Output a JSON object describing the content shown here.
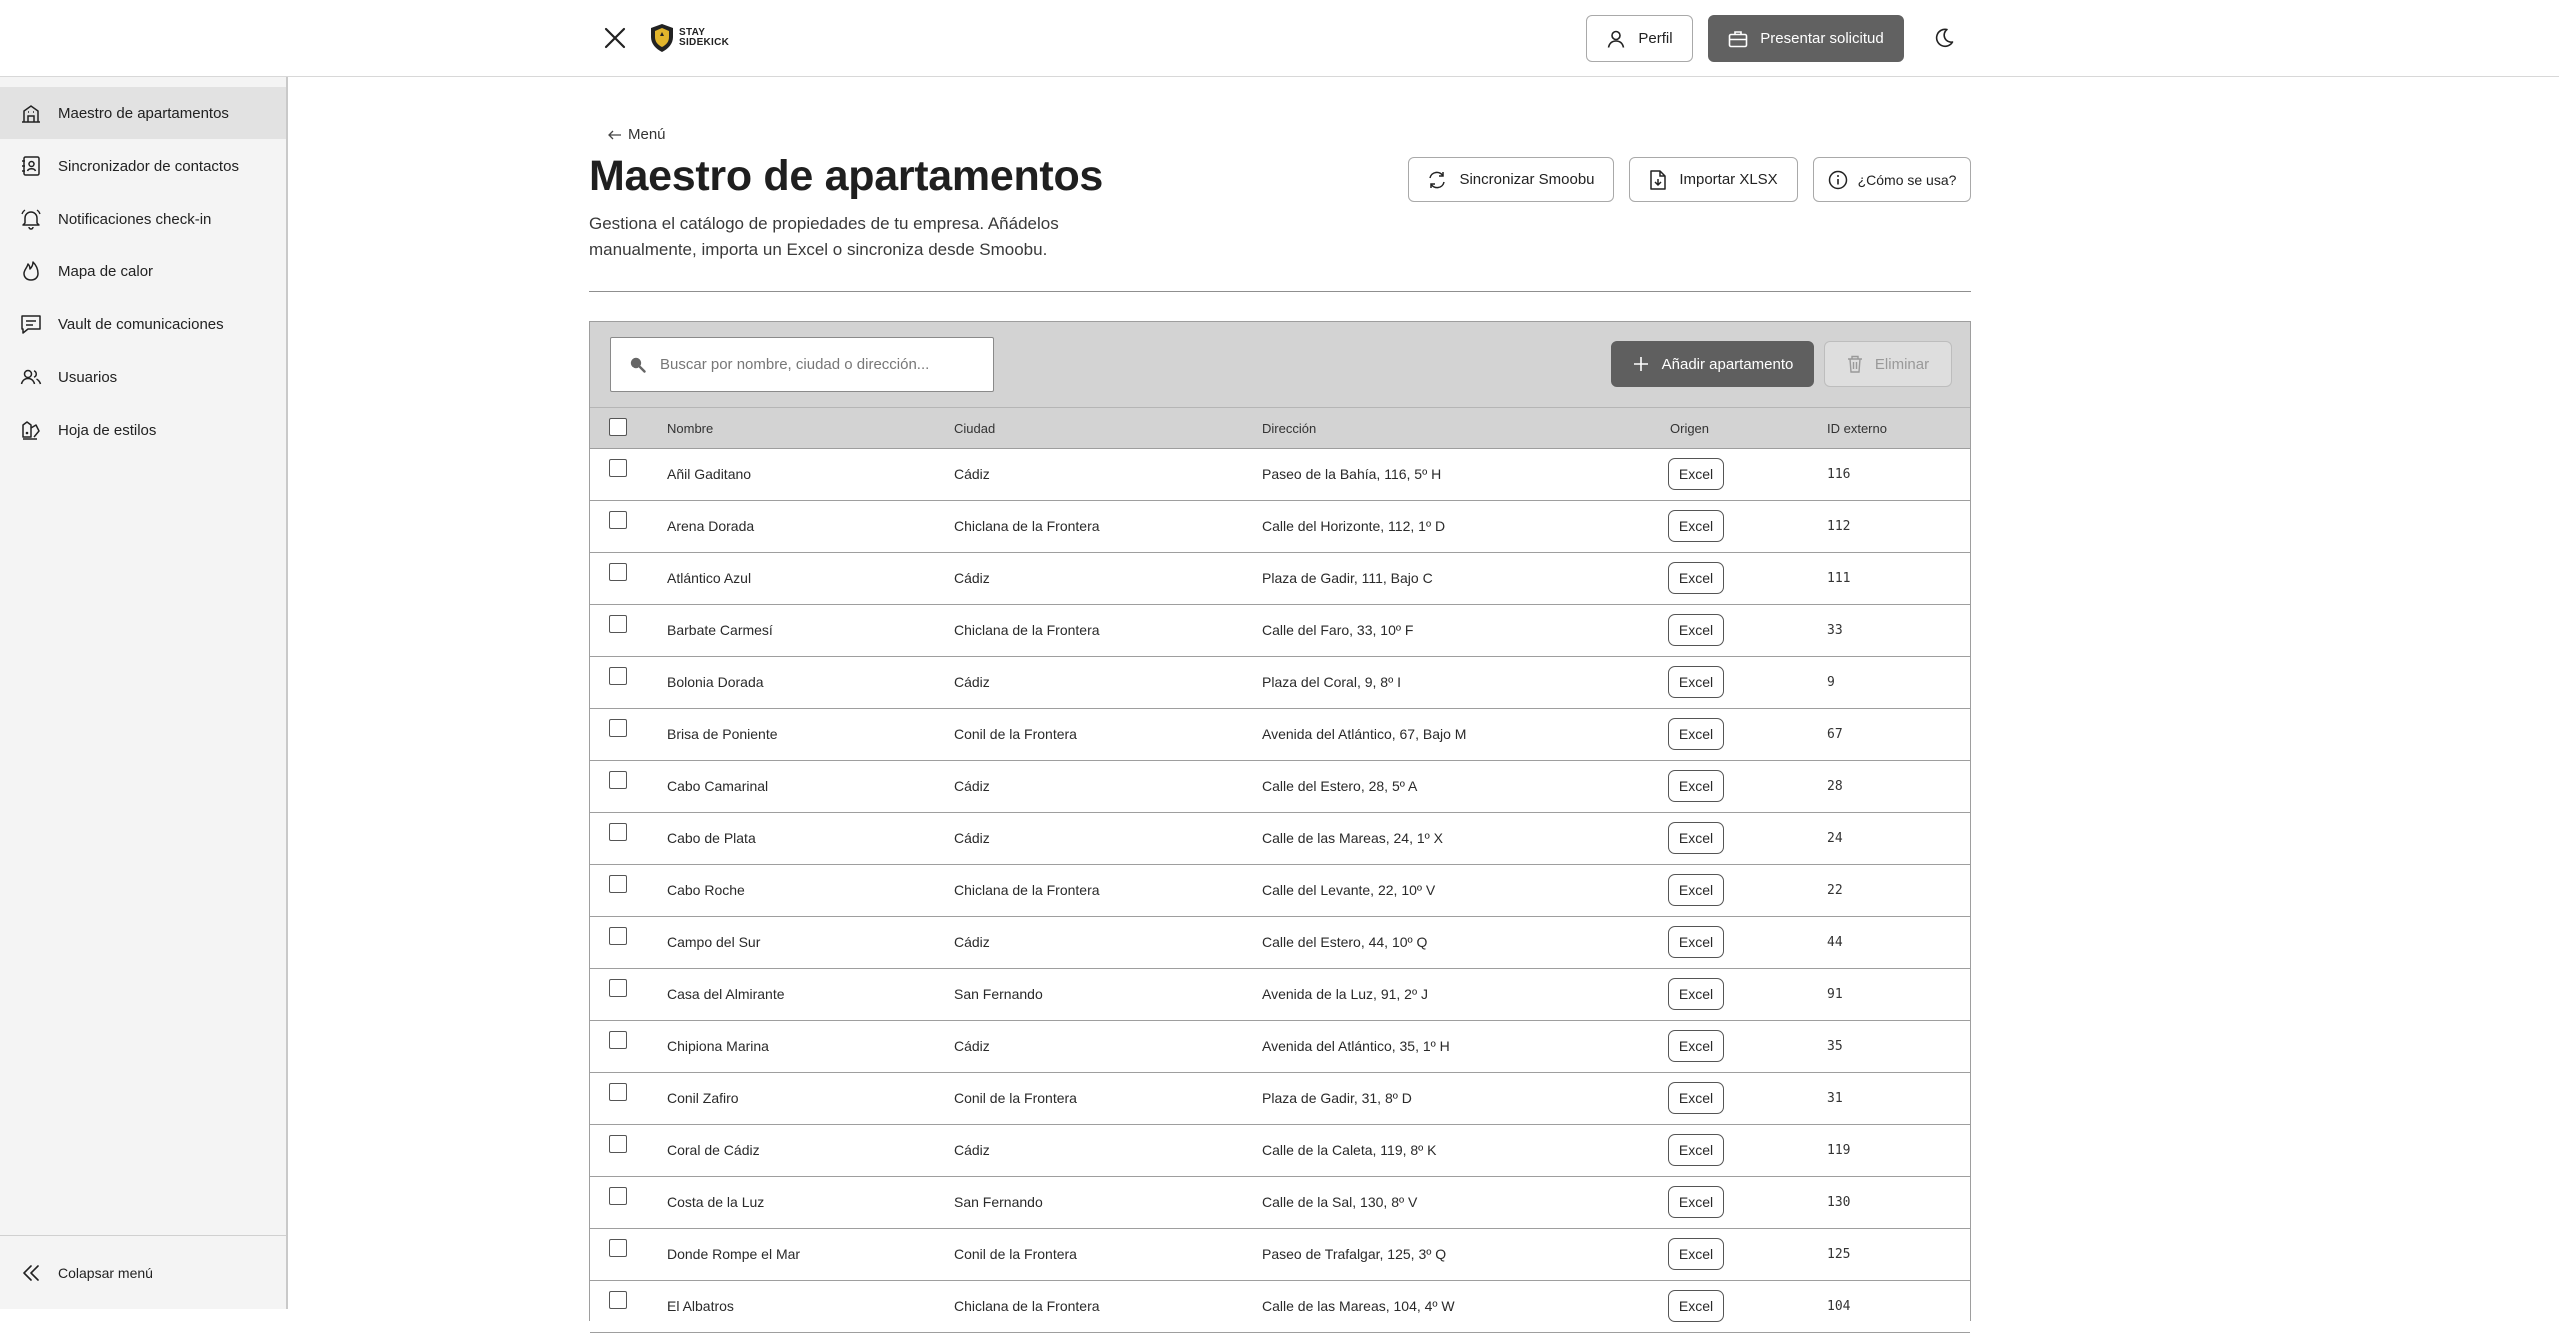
{
  "brand": {
    "logo_line1": "STAY",
    "logo_line2": "SIDEKICK"
  },
  "topbar": {
    "profile_label": "Perfil",
    "submit_label": "Presentar solicitud"
  },
  "sidebar": {
    "items": [
      {
        "label": "Maestro de apartamentos",
        "icon": "building-icon",
        "active": true
      },
      {
        "label": "Sincronizador de contactos",
        "icon": "contact-book-icon",
        "active": false
      },
      {
        "label": "Notificaciones check-in",
        "icon": "bell-icon",
        "active": false
      },
      {
        "label": "Mapa de calor",
        "icon": "flame-icon",
        "active": false
      },
      {
        "label": "Vault de comunicaciones",
        "icon": "message-icon",
        "active": false
      },
      {
        "label": "Usuarios",
        "icon": "users-icon",
        "active": false
      },
      {
        "label": "Hoja de estilos",
        "icon": "palette-icon",
        "active": false
      }
    ],
    "collapse_label": "Colapsar menú"
  },
  "page": {
    "back_label": "Menú",
    "title": "Maestro de apartamentos",
    "description": "Gestiona el catálogo de propiedades de tu empresa. Añádelos manualmente, importa un Excel o sincroniza desde Smoobu.",
    "actions": {
      "sync": "Sincronizar Smoobu",
      "import": "Importar XLSX",
      "help": "¿Cómo se usa?"
    }
  },
  "toolbar": {
    "search_placeholder": "Buscar por nombre, ciudad o dirección...",
    "add_label": "Añadir apartamento",
    "delete_label": "Eliminar"
  },
  "table": {
    "columns": {
      "name": "Nombre",
      "city": "Ciudad",
      "address": "Dirección",
      "origin": "Origen",
      "external_id": "ID externo"
    },
    "rows": [
      {
        "name": "Añil Gaditano",
        "city": "Cádiz",
        "address": "Paseo de la Bahía, 116, 5º H",
        "origin": "Excel",
        "external_id": "116"
      },
      {
        "name": "Arena Dorada",
        "city": "Chiclana de la Frontera",
        "address": "Calle del Horizonte, 112, 1º D",
        "origin": "Excel",
        "external_id": "112"
      },
      {
        "name": "Atlántico Azul",
        "city": "Cádiz",
        "address": "Plaza de Gadir, 111, Bajo C",
        "origin": "Excel",
        "external_id": "111"
      },
      {
        "name": "Barbate Carmesí",
        "city": "Chiclana de la Frontera",
        "address": "Calle del Faro, 33, 10º F",
        "origin": "Excel",
        "external_id": "33"
      },
      {
        "name": "Bolonia Dorada",
        "city": "Cádiz",
        "address": "Plaza del Coral, 9, 8º I",
        "origin": "Excel",
        "external_id": "9"
      },
      {
        "name": "Brisa de Poniente",
        "city": "Conil de la Frontera",
        "address": "Avenida del Atlántico, 67, Bajo M",
        "origin": "Excel",
        "external_id": "67"
      },
      {
        "name": "Cabo Camarinal",
        "city": "Cádiz",
        "address": "Calle del Estero, 28, 5º A",
        "origin": "Excel",
        "external_id": "28"
      },
      {
        "name": "Cabo de Plata",
        "city": "Cádiz",
        "address": "Calle de las Mareas, 24, 1º X",
        "origin": "Excel",
        "external_id": "24"
      },
      {
        "name": "Cabo Roche",
        "city": "Chiclana de la Frontera",
        "address": "Calle del Levante, 22, 10º V",
        "origin": "Excel",
        "external_id": "22"
      },
      {
        "name": "Campo del Sur",
        "city": "Cádiz",
        "address": "Calle del Estero, 44, 10º Q",
        "origin": "Excel",
        "external_id": "44"
      },
      {
        "name": "Casa del Almirante",
        "city": "San Fernando",
        "address": "Avenida de la Luz, 91, 2º J",
        "origin": "Excel",
        "external_id": "91"
      },
      {
        "name": "Chipiona Marina",
        "city": "Cádiz",
        "address": "Avenida del Atlántico, 35, 1º H",
        "origin": "Excel",
        "external_id": "35"
      },
      {
        "name": "Conil Zafiro",
        "city": "Conil de la Frontera",
        "address": "Plaza de Gadir, 31, 8º D",
        "origin": "Excel",
        "external_id": "31"
      },
      {
        "name": "Coral de Cádiz",
        "city": "Cádiz",
        "address": "Calle de la Caleta, 119, 8º K",
        "origin": "Excel",
        "external_id": "119"
      },
      {
        "name": "Costa de la Luz",
        "city": "San Fernando",
        "address": "Calle de la Sal, 130, 8º V",
        "origin": "Excel",
        "external_id": "130"
      },
      {
        "name": "Donde Rompe el Mar",
        "city": "Conil de la Frontera",
        "address": "Paseo de Trafalgar, 125, 3º Q",
        "origin": "Excel",
        "external_id": "125"
      },
      {
        "name": "El Albatros",
        "city": "Chiclana de la Frontera",
        "address": "Calle de las Mareas, 104, 4º W",
        "origin": "Excel",
        "external_id": "104"
      }
    ]
  }
}
